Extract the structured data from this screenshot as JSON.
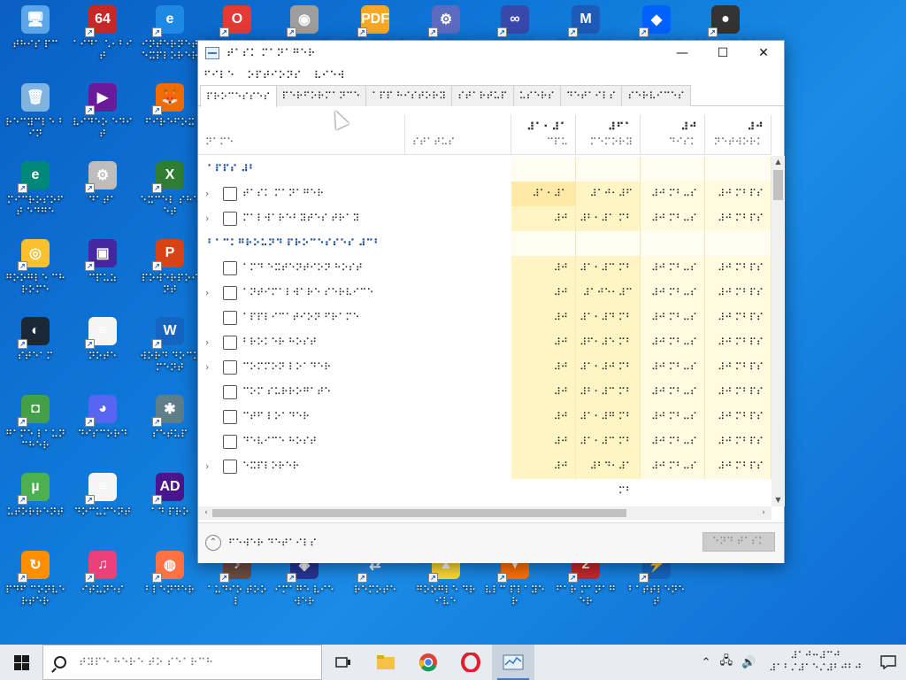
{
  "desktop": {
    "icons": [
      {
        "label": "⠞⠓⠊⠎ ⠏⠉",
        "glyph": "🖥",
        "color": "#5aa6e8",
        "name": "this-pc-icon"
      },
      {
        "label": "⠁⠊⠙⠁ ⠡⠂⠃⠊⠞",
        "glyph": "64",
        "color": "#c62828",
        "name": "aida64-icon"
      },
      {
        "label": "⠊⠝⠞⠑⠗⠝⠑⠞ ⠑⠭⠏⠇⠕⠗⠑⠗",
        "glyph": "e",
        "color": "#1e88e5",
        "name": "internet-explorer-icon"
      },
      {
        "label": "⠕⠏⠑⠗⠁ ⠃⠗⠕⠺⠎⠑⠗",
        "glyph": "O",
        "color": "#e53935",
        "name": "opera-icon"
      },
      {
        "label": "⠊⠍⠛⠃⠥⠗⠝",
        "glyph": "◉",
        "color": "#9e9e9e",
        "name": "imgburn-icon"
      },
      {
        "label": "⠏⠙⠋ ⠭⠉⠓⠁⠝⠛⠑",
        "glyph": "PDF",
        "color": "#f9a825",
        "name": "pdf-xchange-icon"
      },
      {
        "label": "⠝⠑⠞⠺⠕⠗⠅",
        "glyph": "⚙",
        "color": "#5c6bc0",
        "name": "network-icon"
      },
      {
        "label": "⠧⠍⠺⠁⠗⠑",
        "glyph": "∞",
        "color": "#3949ab",
        "name": "vmware-icon"
      },
      {
        "label": "⠍⠁⠇⠺⠁⠗⠑⠃⠽⠞⠑⠎",
        "glyph": "M",
        "color": "#1e5bb8",
        "name": "malwarebytes-icon"
      },
      {
        "label": "⠙⠗⠕⠏⠃⠕⠭",
        "glyph": "◆",
        "color": "#0061fe",
        "name": "dropbox-icon"
      },
      {
        "label": "⠕⠃⠎ ⠎⠞⠥⠙⠊⠕",
        "glyph": "●",
        "color": "#333",
        "name": "obs-icon"
      },
      {
        "label": "⠗⠑⠉⠽⠉⠇⠑ ⠃⠊⠝",
        "glyph": "🗑",
        "color": "#7fb3e0",
        "name": "recycle-bin-icon"
      },
      {
        "label": "⠧⠊⠙⠑⠕ ⠑⠙⠊⠞",
        "glyph": "▶",
        "color": "#6a1b9a",
        "name": "video-editor-icon"
      },
      {
        "label": "⠋⠊⠗⠑⠋⠕⠭",
        "glyph": "🦊",
        "color": "#ef6c00",
        "name": "firefox-icon"
      },
      {
        "label": "⠍⠊⠉⠗⠕⠎⠕⠋⠞ ⠑⠙⠛⠑",
        "glyph": "e",
        "color": "#00897b",
        "name": "edge-icon"
      },
      {
        "label": "⠙⠁⠞⠁",
        "glyph": "⚙",
        "color": "#bdbdbd",
        "name": "settings-file-icon"
      },
      {
        "label": "⠑⠭⠉⠑⠇ ⠎⠓⠑⠑⠞",
        "glyph": "X",
        "color": "#2e7d32",
        "name": "excel-icon"
      },
      {
        "label": "⠛⠕⠕⠛⠇⠑ ⠉⠓⠗⠕⠍⠑",
        "glyph": "◎",
        "color": "#fbc02d",
        "name": "chrome-icon"
      },
      {
        "label": "⠉⠏⠥⠵",
        "glyph": "▣",
        "color": "#4527a0",
        "name": "cpuz-icon"
      },
      {
        "label": "⠏⠕⠺⠑⠗⠏⠕⠊⠝⠞",
        "glyph": "P",
        "color": "#d84315",
        "name": "powerpoint-icon"
      },
      {
        "label": "⠎⠞⠑⠁⠍",
        "glyph": "◐",
        "color": "#1b2838",
        "name": "steam-icon"
      },
      {
        "label": "⠝⠕⠞⠑",
        "glyph": "≡",
        "color": "#f5f5f5",
        "name": "text-file-icon"
      },
      {
        "label": "⠺⠕⠗⠙ ⠙⠕⠉⠥⠍⠑⠝⠞",
        "glyph": "W",
        "color": "#1565c0",
        "name": "word-icon"
      },
      {
        "label": "⠛⠁⠍⠑ ⠇⠁⠥⠝⠉⠓⠑⠗",
        "glyph": "◘",
        "color": "#43a047",
        "name": "game-launcher-icon"
      },
      {
        "label": "⠙⠊⠎⠉⠕⠗⠙",
        "glyph": "◕",
        "color": "#5865f2",
        "name": "discord-icon"
      },
      {
        "label": "⠎⠑⠞⠥⠏",
        "glyph": "✱",
        "color": "#607d8b",
        "name": "setup-icon"
      },
      {
        "label": "⠥⠞⠕⠗⠗⠑⠝⠞",
        "glyph": "µ",
        "color": "#4caf50",
        "name": "utorrent-icon"
      },
      {
        "label": "⠙⠕⠉⠥⠍⠑⠝⠞",
        "glyph": "≡",
        "color": "#f5f5f5",
        "name": "document-icon"
      },
      {
        "label": "⠁⠙ ⠏⠗⠕",
        "glyph": "AD",
        "color": "#4a148c",
        "name": "ad-pro-icon"
      },
      {
        "label": "⠏⠙⠋ ⠉⠕⠝⠧⠑⠗⠞⠑⠗",
        "glyph": "↻",
        "color": "#ff8f00",
        "name": "pdf-converter-icon"
      },
      {
        "label": "⠊⠞⠥⠝⠑⠎",
        "glyph": "♫",
        "color": "#ec407a",
        "name": "itunes-icon"
      },
      {
        "label": "⠃⠇⠑⠝⠙⠑⠗",
        "glyph": "◍",
        "color": "#ff7043",
        "name": "blender-icon"
      },
      {
        "label": "⠁⠥⠙⠊⠕ ⠞⠕⠕⠇",
        "glyph": "♪",
        "color": "#6d4c41",
        "name": "audio-tool-icon"
      },
      {
        "label": "⠊⠍⠁⠛⠑ ⠧⠊⠑⠺⠑⠗",
        "glyph": "◈",
        "color": "#283593",
        "name": "image-viewer-icon"
      },
      {
        "label": "⠗⠑⠍⠕⠞⠑",
        "glyph": "⇄",
        "color": "#1e88e5",
        "name": "remote-icon"
      },
      {
        "label": "⠛⠕⠕⠛⠇⠑ ⠙⠗⠊⠧⠑",
        "glyph": "▲",
        "color": "#fdd835",
        "name": "google-drive-icon"
      },
      {
        "label": "⠧⠇⠉ ⠏⠇⠁⠽⠑⠗",
        "glyph": "▼",
        "color": "#ff6f00",
        "name": "vlc-icon"
      },
      {
        "label": "⠋⠁⠗ ⠍⠁⠝⠁⠛⠑⠗",
        "glyph": "2",
        "color": "#c62828",
        "name": "far-manager-icon"
      },
      {
        "label": "⠃⠁⠞⠞⠇⠑⠝⠑⠞",
        "glyph": "⚡",
        "color": "#1565c0",
        "name": "battlenet-icon"
      }
    ]
  },
  "window": {
    "title": "⠞⠁⠎⠅ ⠍⠁⠝⠁⠛⠑⠗",
    "min": "—",
    "max": "☐",
    "close": "✕",
    "menu": [
      "⠋⠊⠇⠑",
      "⠕⠏⠞⠊⠕⠝⠎",
      "⠧⠊⠑⠺"
    ],
    "tabs": [
      "⠏⠗⠕⠉⠑⠎⠎⠑⠎",
      "⠏⠑⠗⠋⠕⠗⠍⠁⠝⠉⠑",
      "⠁⠏⠏ ⠓⠊⠎⠞⠕⠗⠽",
      "⠎⠞⠁⠗⠞⠥⠏",
      "⠥⠎⠑⠗⠎",
      "⠙⠑⠞⠁⠊⠇⠎",
      "⠎⠑⠗⠧⠊⠉⠑⠎"
    ],
    "columns": {
      "name": "⠝⠁⠍⠑",
      "status": "⠎⠞⠁⠞⠥⠎",
      "cpu": {
        "pct": "⠼⠁⠂⠼⠁",
        "label": "⠉⠏⠥"
      },
      "memory": {
        "pct": "⠼⠋⠁",
        "label": "⠍⠑⠍⠕⠗⠽"
      },
      "disk": {
        "pct": "⠼⠚",
        "label": "⠙⠊⠎⠅"
      },
      "network": {
        "pct": "⠼⠚",
        "label": "⠝⠑⠞⠺⠕⠗⠅"
      }
    },
    "rows": [
      {
        "type": "group",
        "name": "⠁⠏⠏⠎ ⠼⠃"
      },
      {
        "type": "app",
        "name": "⠞⠁⠎⠅ ⠍⠁⠝⠁⠛⠑⠗",
        "cpu": "⠼⠁⠂⠼⠁",
        "mem": "⠼⠁⠚⠂⠼⠋ ⠍⠃",
        "disk": "⠼⠚ ⠍⠃⠤⠎",
        "net": "⠼⠚ ⠍⠃⠏⠎",
        "chev": "›"
      },
      {
        "type": "app",
        "name": "⠍⠁⠇⠺⠁⠗⠑⠃⠽⠞⠑⠎ ⠞⠗⠁⠽",
        "cpu": "⠼⠚",
        "mem": "⠼⠃⠂⠼⠁ ⠍⠃",
        "disk": "⠼⠚ ⠍⠃⠤⠎",
        "net": "⠼⠚ ⠍⠃⠏⠎",
        "chev": "›"
      },
      {
        "type": "group",
        "name": "⠃⠁⠉⠅⠛⠗⠕⠥⠝⠙ ⠏⠗⠕⠉⠑⠎⠎⠑⠎ ⠼⠉⠃"
      },
      {
        "type": "proc",
        "name": "⠁⠍⠙ ⠑⠭⠞⠑⠝⠞⠊⠕⠝ ⠓⠕⠎⠞",
        "cpu": "⠼⠚",
        "mem": "⠼⠁⠂⠼⠉ ⠍⠃",
        "disk": "⠼⠚ ⠍⠃⠤⠎",
        "net": "⠼⠚ ⠍⠃⠏⠎",
        "chev": ""
      },
      {
        "type": "proc",
        "name": "⠁⠝⠞⠊⠍⠁⠇⠺⠁⠗⠑ ⠎⠑⠗⠧⠊⠉⠑",
        "cpu": "⠼⠚",
        "mem": "⠼⠁⠚⠑⠂⠼⠉ ⠍⠃",
        "disk": "⠼⠚ ⠍⠃⠤⠎",
        "net": "⠼⠚ ⠍⠃⠏⠎",
        "chev": "›"
      },
      {
        "type": "proc",
        "name": "⠁⠏⠏⠇⠊⠉⠁⠞⠊⠕⠝ ⠋⠗⠁⠍⠑",
        "cpu": "⠼⠚",
        "mem": "⠼⠁⠂⠼⠙ ⠍⠃",
        "disk": "⠼⠚ ⠍⠃⠤⠎",
        "net": "⠼⠚ ⠍⠃⠏⠎",
        "chev": ""
      },
      {
        "type": "proc",
        "name": "⠃⠗⠕⠅⠑⠗ ⠓⠕⠎⠞",
        "cpu": "⠼⠚",
        "mem": "⠼⠋⠂⠼⠑ ⠍⠃",
        "disk": "⠼⠚ ⠍⠃⠤⠎",
        "net": "⠼⠚ ⠍⠃⠏⠎",
        "chev": "›"
      },
      {
        "type": "proc",
        "name": "⠉⠕⠍⠍⠕⠝ ⠇⠕⠁⠙⠑⠗",
        "cpu": "⠼⠚",
        "mem": "⠼⠁⠂⠼⠚ ⠍⠃",
        "disk": "⠼⠚ ⠍⠃⠤⠎",
        "net": "⠼⠚ ⠍⠃⠏⠎",
        "chev": "›"
      },
      {
        "type": "proc",
        "name": "⠉⠕⠍ ⠎⠥⠗⠗⠕⠛⠁⠞⠑",
        "cpu": "⠼⠚",
        "mem": "⠼⠃⠂⠼⠉ ⠍⠃",
        "disk": "⠼⠚ ⠍⠃⠤⠎",
        "net": "⠼⠚ ⠍⠃⠏⠎",
        "chev": ""
      },
      {
        "type": "proc",
        "name": "⠉⠞⠋ ⠇⠕⠁⠙⠑⠗",
        "cpu": "⠼⠚",
        "mem": "⠼⠁⠂⠼⠛ ⠍⠃",
        "disk": "⠼⠚ ⠍⠃⠤⠎",
        "net": "⠼⠚ ⠍⠃⠏⠎",
        "chev": ""
      },
      {
        "type": "proc",
        "name": "⠙⠑⠧⠊⠉⠑ ⠓⠕⠎⠞",
        "cpu": "⠼⠚",
        "mem": "⠼⠁⠂⠼⠉ ⠍⠃",
        "disk": "⠼⠚ ⠍⠃⠤⠎",
        "net": "⠼⠚ ⠍⠃⠏⠎",
        "chev": ""
      },
      {
        "type": "proc",
        "name": "⠑⠭⠏⠇⠕⠗⠑⠗",
        "cpu": "⠼⠚",
        "mem": "⠼⠃⠙⠂⠼⠁ ⠍⠃",
        "disk": "⠼⠚ ⠍⠃⠤⠎",
        "net": "⠼⠚ ⠍⠃⠏⠎",
        "chev": "›"
      }
    ],
    "fewer_details": "⠋⠑⠺⠑⠗ ⠙⠑⠞⠁⠊⠇⠎",
    "end_task": "⠑⠝⠙ ⠞⠁⠎⠅",
    "chevron_down": "⌃",
    "hscroll_left": "‹",
    "hscroll_right": "›",
    "vscroll_up": "▲",
    "vscroll_down": "▼"
  },
  "taskbar": {
    "search_placeholder": "⠞⠽⠏⠑ ⠓⠑⠗⠑ ⠞⠕ ⠎⠑⠁⠗⠉⠓",
    "clock_time": "⠼⠁⠚⠒⠼⠉⠚",
    "clock_date": "⠼⠁⠃⠌⠼⠁⠑⠌⠼⠃⠚⠃⠚",
    "tray": [
      "⌃",
      "🖧",
      "🔊"
    ]
  },
  "colors": {
    "cpu_highlight": "#ffe9a6",
    "cpu_bg": "#fff4c4",
    "mem_bg": "#fff4c4",
    "disk_bg": "#fffae0"
  }
}
